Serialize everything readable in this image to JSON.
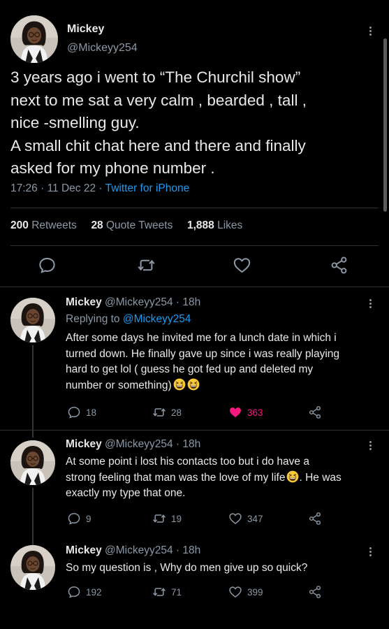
{
  "main_tweet": {
    "name": "Mickey",
    "handle": "@Mickeyy254",
    "text_lines": [
      "3 years ago i went to “The Churchil show”",
      "next to me sat a very calm , bearded , tall ,",
      "nice -smelling guy.",
      "A small chit chat here and there and finally",
      "asked for my phone number ."
    ],
    "time": "17:26",
    "date": "11 Dec 22",
    "source": "Twitter for iPhone",
    "retweets_count": "200",
    "retweets_label": "Retweets",
    "quotes_count": "28",
    "quotes_label": "Quote Tweets",
    "likes_count": "1,888",
    "likes_label": "Likes"
  },
  "replies": [
    {
      "name": "Mickey",
      "handle": "@Mickeyy254",
      "age": "18h",
      "replying_label": "Replying to",
      "replying_to": "@Mickeyy254",
      "text_lines": [
        "After some days he invited me for a lunch date in which i",
        "turned down. He finally gave up since i was really playing",
        "hard to get lol ( guess he got fed up and deleted my",
        "number or something)"
      ],
      "replies": "18",
      "retweets": "28",
      "likes": "363"
    },
    {
      "name": "Mickey",
      "handle": "@Mickeyy254",
      "age": "18h",
      "text_lines": [
        "At some point i lost his contacts too but i do have a",
        "strong feeling that man was the love of my life",
        ". He was",
        "exactly my type that one."
      ],
      "replies": "9",
      "retweets": "19",
      "likes": "347"
    },
    {
      "name": "Mickey",
      "handle": "@Mickeyy254",
      "age": "18h",
      "text_lines": [
        "So my question is , Why do men give up so quick?"
      ],
      "replies": "192",
      "retweets": "71",
      "likes": "399"
    }
  ],
  "icons": {
    "reply": "comment-icon",
    "retweet": "retweet-icon",
    "like": "heart-icon",
    "share": "share-icon",
    "more": "more-options-icon",
    "emoji": "grinning-squinting-face-emoji"
  },
  "colors": {
    "background": "#000000",
    "text": "#e7e9ea",
    "secondary": "#8b98a5",
    "link": "#1d9bf0",
    "like": "#f91880"
  }
}
